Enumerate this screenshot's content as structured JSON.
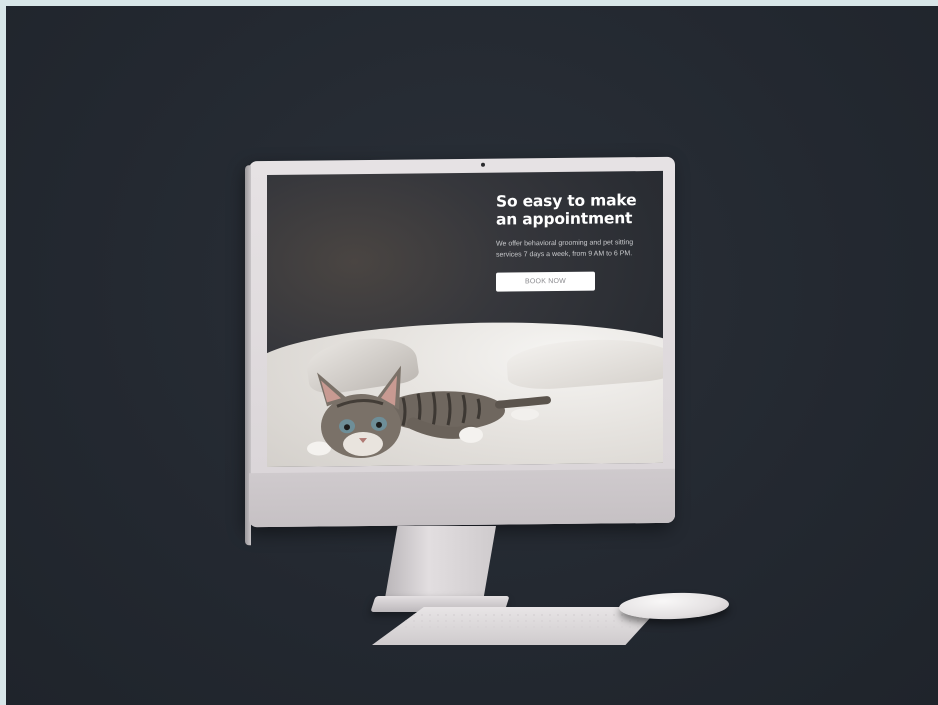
{
  "hero": {
    "title": "So easy to make an appointment",
    "description": "We offer behavioral grooming and pet sitting services 7 days a week, from 9 AM to 6 PM.",
    "button_label": "BOOK NOW"
  },
  "colors": {
    "background": "#232830",
    "screen_bg": "#2a2d33",
    "button_bg": "#ffffff",
    "title_text": "#ffffff"
  }
}
